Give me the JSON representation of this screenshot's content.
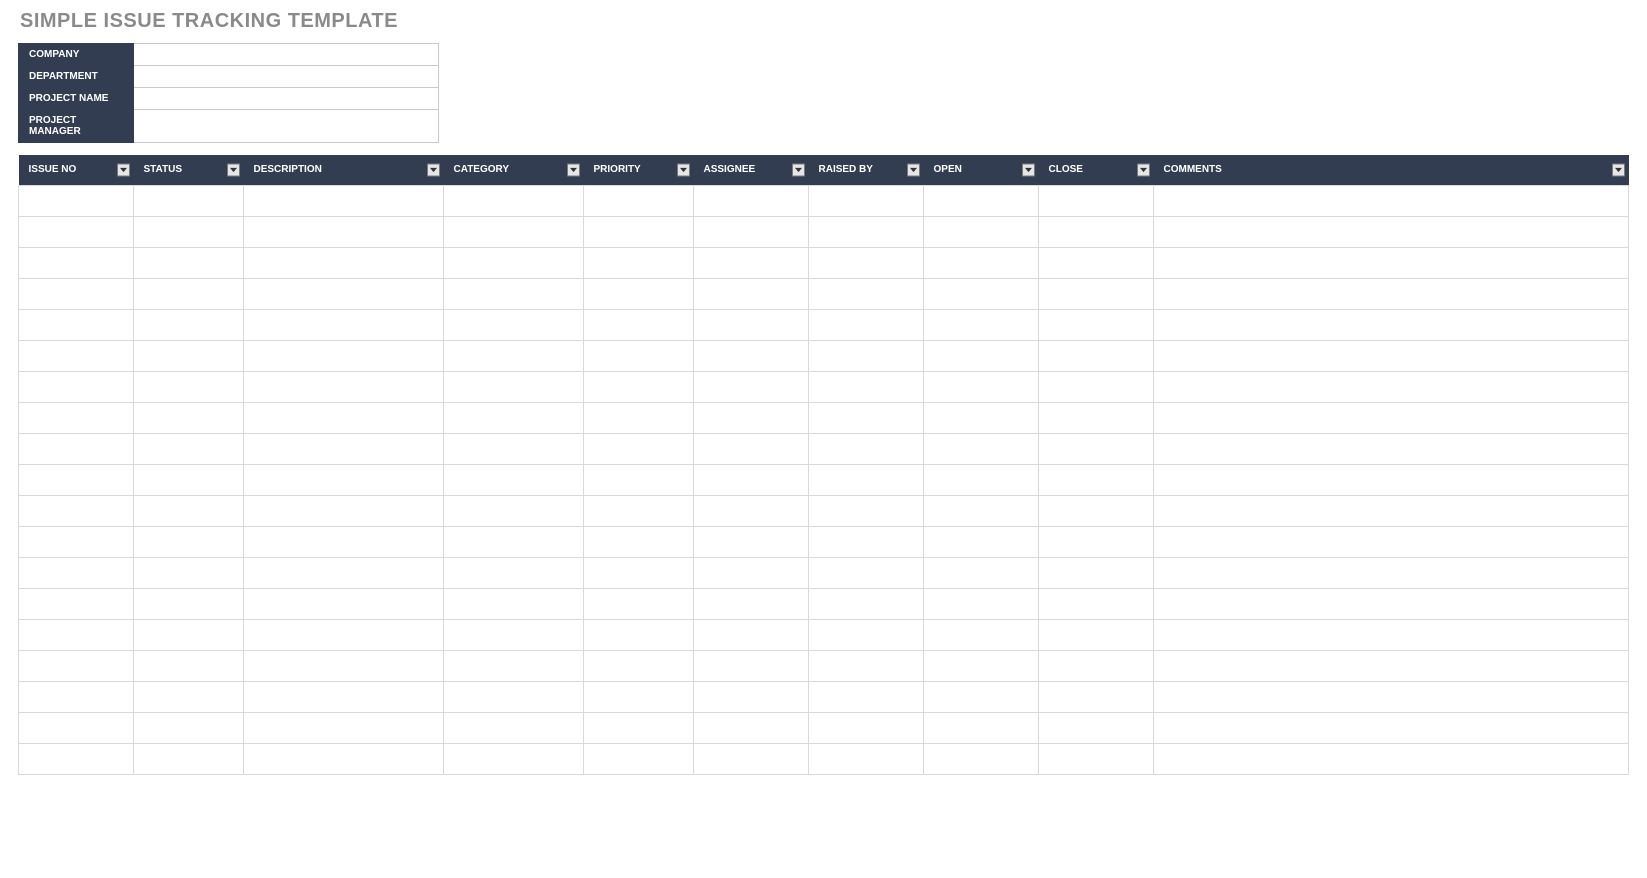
{
  "title": "SIMPLE ISSUE TRACKING TEMPLATE",
  "meta": {
    "rows": [
      {
        "label": "COMPANY",
        "value": ""
      },
      {
        "label": "DEPARTMENT",
        "value": ""
      },
      {
        "label": "PROJECT NAME",
        "value": ""
      },
      {
        "label": "PROJECT MANAGER",
        "value": ""
      }
    ]
  },
  "table": {
    "columns": [
      {
        "label": "ISSUE NO",
        "class": "col-issue"
      },
      {
        "label": "STATUS",
        "class": "col-status"
      },
      {
        "label": "DESCRIPTION",
        "class": "col-desc"
      },
      {
        "label": "CATEGORY",
        "class": "col-category"
      },
      {
        "label": "PRIORITY",
        "class": "col-priority"
      },
      {
        "label": "ASSIGNEE",
        "class": "col-assignee"
      },
      {
        "label": "RAISED BY",
        "class": "col-raised"
      },
      {
        "label": "OPEN",
        "class": "col-open"
      },
      {
        "label": "CLOSE",
        "class": "col-close"
      },
      {
        "label": "COMMENTS",
        "class": "col-comments"
      }
    ],
    "rows": [
      [
        "",
        "",
        "",
        "",
        "",
        "",
        "",
        "",
        "",
        ""
      ],
      [
        "",
        "",
        "",
        "",
        "",
        "",
        "",
        "",
        "",
        ""
      ],
      [
        "",
        "",
        "",
        "",
        "",
        "",
        "",
        "",
        "",
        ""
      ],
      [
        "",
        "",
        "",
        "",
        "",
        "",
        "",
        "",
        "",
        ""
      ],
      [
        "",
        "",
        "",
        "",
        "",
        "",
        "",
        "",
        "",
        ""
      ],
      [
        "",
        "",
        "",
        "",
        "",
        "",
        "",
        "",
        "",
        ""
      ],
      [
        "",
        "",
        "",
        "",
        "",
        "",
        "",
        "",
        "",
        ""
      ],
      [
        "",
        "",
        "",
        "",
        "",
        "",
        "",
        "",
        "",
        ""
      ],
      [
        "",
        "",
        "",
        "",
        "",
        "",
        "",
        "",
        "",
        ""
      ],
      [
        "",
        "",
        "",
        "",
        "",
        "",
        "",
        "",
        "",
        ""
      ],
      [
        "",
        "",
        "",
        "",
        "",
        "",
        "",
        "",
        "",
        ""
      ],
      [
        "",
        "",
        "",
        "",
        "",
        "",
        "",
        "",
        "",
        ""
      ],
      [
        "",
        "",
        "",
        "",
        "",
        "",
        "",
        "",
        "",
        ""
      ],
      [
        "",
        "",
        "",
        "",
        "",
        "",
        "",
        "",
        "",
        ""
      ],
      [
        "",
        "",
        "",
        "",
        "",
        "",
        "",
        "",
        "",
        ""
      ],
      [
        "",
        "",
        "",
        "",
        "",
        "",
        "",
        "",
        "",
        ""
      ],
      [
        "",
        "",
        "",
        "",
        "",
        "",
        "",
        "",
        "",
        ""
      ],
      [
        "",
        "",
        "",
        "",
        "",
        "",
        "",
        "",
        "",
        ""
      ],
      [
        "",
        "",
        "",
        "",
        "",
        "",
        "",
        "",
        "",
        ""
      ]
    ]
  }
}
